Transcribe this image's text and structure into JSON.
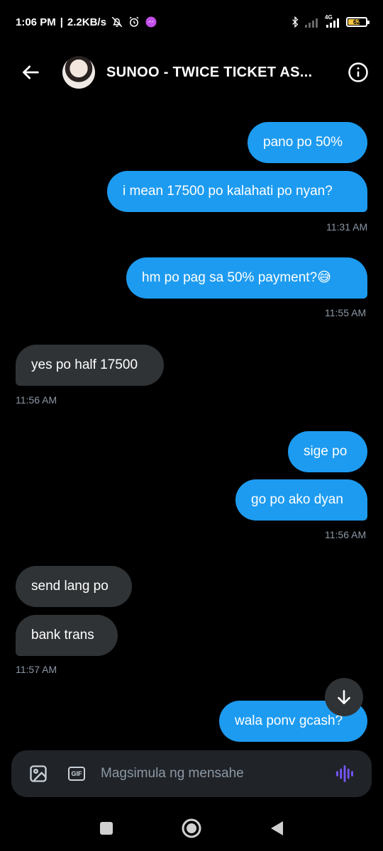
{
  "status_bar": {
    "time": "1:06 PM",
    "separator": "|",
    "speed": "2.2KB/s",
    "network": "4G",
    "battery_level": "62"
  },
  "header": {
    "title": "SUNOO - TWICE TICKET AS..."
  },
  "messages": [
    {
      "side": "sent",
      "text": "pano po 50%"
    },
    {
      "side": "sent",
      "text": "i mean 17500 po kalahati po nyan?"
    },
    {
      "side": "sent",
      "text": "hm po pag sa 50% payment?😅"
    },
    {
      "side": "received",
      "text": "yes po half 17500"
    },
    {
      "side": "sent",
      "text": "sige po"
    },
    {
      "side": "sent",
      "text": "go po ako dyan"
    },
    {
      "side": "received",
      "text": "send lang po"
    },
    {
      "side": "received",
      "text": "bank trans"
    },
    {
      "side": "sent",
      "text": "wala ponv gcash?"
    }
  ],
  "timestamps": [
    "11:31 AM",
    "11:55 AM",
    "11:56 AM",
    "11:56 AM",
    "11:57 AM"
  ],
  "composer": {
    "placeholder": "Magsimula ng mensahe",
    "gif_label": "GIF"
  },
  "colors": {
    "sent_bubble": "#1d9bf0",
    "received_bubble": "#2f3336",
    "voice_icon": "#7856ff"
  }
}
